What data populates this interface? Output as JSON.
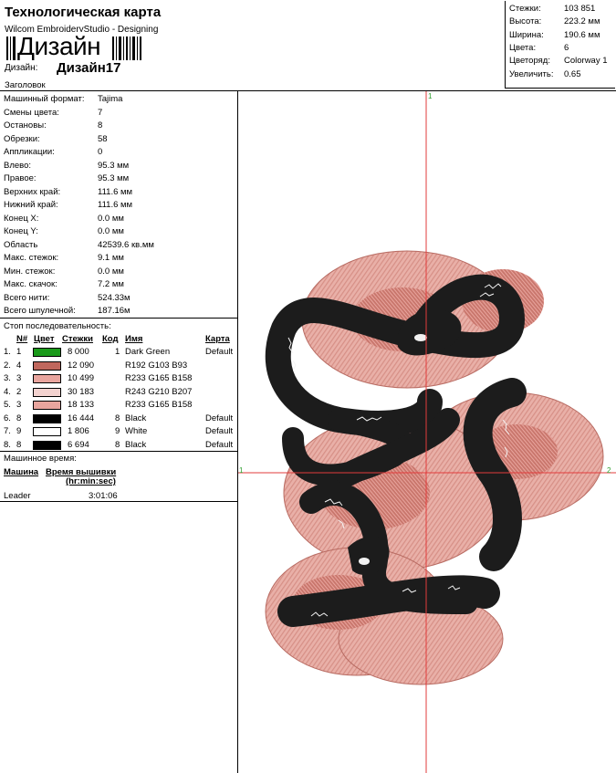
{
  "header": {
    "title": "Технологическая карта",
    "subtitle": "Wilcom EmbroideryStudio - Designing",
    "barcode_text": "Дизайн",
    "design_label": "Дизайн:",
    "design_name": "Дизайн17",
    "caption_label": "Заголовок"
  },
  "stats": [
    {
      "label": "Стежки:",
      "value": "103 851"
    },
    {
      "label": "Высота:",
      "value": "223.2 мм"
    },
    {
      "label": "Ширина:",
      "value": "190.6 мм"
    },
    {
      "label": "Цвета:",
      "value": "6"
    },
    {
      "label": "Цветоряд:",
      "value": "Colorway 1"
    },
    {
      "label": "Увеличить:",
      "value": "0.65"
    }
  ],
  "info": [
    {
      "label": "Машинный формат:",
      "value": "Tajima"
    },
    {
      "label": "Смены цвета:",
      "value": "7"
    },
    {
      "label": "Остановы:",
      "value": "8"
    },
    {
      "label": "Обрезки:",
      "value": "58"
    },
    {
      "label": "Аппликации:",
      "value": "0"
    },
    {
      "label": "Влево:",
      "value": "95.3 мм"
    },
    {
      "label": "Правое:",
      "value": "95.3 мм"
    },
    {
      "label": "Верхних край:",
      "value": "111.6 мм"
    },
    {
      "label": "Нижний край:",
      "value": "111.6 мм"
    },
    {
      "label": "Конец X:",
      "value": "0.0 мм"
    },
    {
      "label": "Конец Y:",
      "value": "0.0 мм"
    },
    {
      "label": "Область",
      "value": "42539.6 кв.мм"
    },
    {
      "label": "Макс. стежок:",
      "value": "9.1 мм"
    },
    {
      "label": "Мин. стежок:",
      "value": "0.0 мм"
    },
    {
      "label": "Макс. скачок:",
      "value": "7.2 мм"
    },
    {
      "label": "Всего нити:",
      "value": "524.33м"
    },
    {
      "label": "Всего шпулечной:",
      "value": "187.16м"
    }
  ],
  "sequence": {
    "title": "Стоп последовательность:",
    "columns": {
      "n": "N#",
      "color": "Цвет",
      "stitches": "Стежки",
      "code": "Код",
      "name": "Имя",
      "chart": "Карта"
    },
    "rows": [
      {
        "stop": "1.",
        "n": "1",
        "color": "#1a9a1a",
        "stitches": "8 000",
        "code": "1",
        "name": "Dark Green",
        "chart": "Default"
      },
      {
        "stop": "2.",
        "n": "4",
        "color": "#c0675d",
        "stitches": "12 090",
        "code": "",
        "name": "R192 G103 B93",
        "chart": ""
      },
      {
        "stop": "3.",
        "n": "3",
        "color": "#e9a59e",
        "stitches": "10 499",
        "code": "",
        "name": "R233 G165 B158",
        "chart": ""
      },
      {
        "stop": "4.",
        "n": "2",
        "color": "#f3d2cf",
        "stitches": "30 183",
        "code": "",
        "name": "R243 G210 B207",
        "chart": ""
      },
      {
        "stop": "5.",
        "n": "3",
        "color": "#e9a59e",
        "stitches": "18 133",
        "code": "",
        "name": "R233 G165 B158",
        "chart": ""
      },
      {
        "stop": "6.",
        "n": "8",
        "color": "#000000",
        "stitches": "16 444",
        "code": "8",
        "name": "Black",
        "chart": "Default"
      },
      {
        "stop": "7.",
        "n": "9",
        "color": "#ffffff",
        "stitches": "1 806",
        "code": "9",
        "name": "White",
        "chart": "Default"
      },
      {
        "stop": "8.",
        "n": "8",
        "color": "#000000",
        "stitches": "6 694",
        "code": "8",
        "name": "Black",
        "chart": "Default"
      }
    ]
  },
  "machine_time": {
    "title": "Машинное время:",
    "col_machine": "Машина",
    "col_time": "Время вышивки",
    "col_time_unit": "(hr:min:sec)",
    "rows": [
      {
        "machine": "Leader",
        "time": "3:01:06"
      }
    ]
  },
  "preview": {
    "axis_top": "1",
    "axis_left": "1",
    "axis_right": "2"
  }
}
